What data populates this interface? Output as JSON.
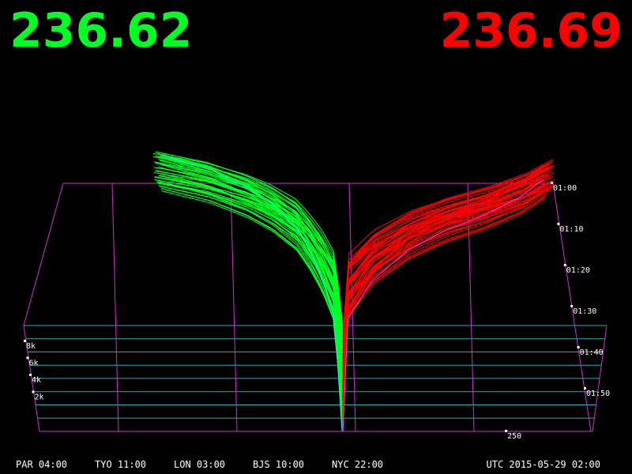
{
  "prices": {
    "bid": "236.62",
    "ask": "236.69"
  },
  "colors": {
    "bid": "#00ff22",
    "ask": "#ff0000",
    "grid": "#cc33cc",
    "base_bid": "#33e0e0",
    "base_ask": "#ff33ff",
    "background": "#000000"
  },
  "clocks": [
    "PAR 04:00",
    "TYO 11:00",
    "LON 03:00",
    "BJS 10:00",
    "NYC 22:00"
  ],
  "utc": "UTC 2015-05-29 02:00",
  "chart_data": {
    "type": "area",
    "view": "3d-perspective order book depth over time",
    "price_axis": {
      "tick_labels": [
        "250"
      ],
      "ticks": [
        250
      ]
    },
    "volume_axis": {
      "tick_labels": [
        "2k",
        "4k",
        "6k",
        "8k"
      ],
      "ticks": [
        2000,
        4000,
        6000,
        8000
      ]
    },
    "time_axis": {
      "tick_labels": [
        "01:00",
        "01:10",
        "01:20",
        "01:30",
        "01:40",
        "01:50"
      ]
    },
    "series": [
      {
        "side": "bid",
        "color": "#00ff22",
        "price": [
          222,
          226,
          229,
          231,
          233,
          234,
          235,
          236,
          236.62
        ],
        "cumulative_volume": [
          18500,
          17500,
          16300,
          15200,
          13600,
          12100,
          10300,
          7800,
          0
        ]
      },
      {
        "side": "ask",
        "color": "#ff0000",
        "price": [
          236.69,
          237,
          239,
          242,
          245,
          248,
          251,
          253
        ],
        "cumulative_volume": [
          0,
          7800,
          10600,
          12800,
          14200,
          15200,
          16500,
          17800
        ]
      }
    ]
  }
}
